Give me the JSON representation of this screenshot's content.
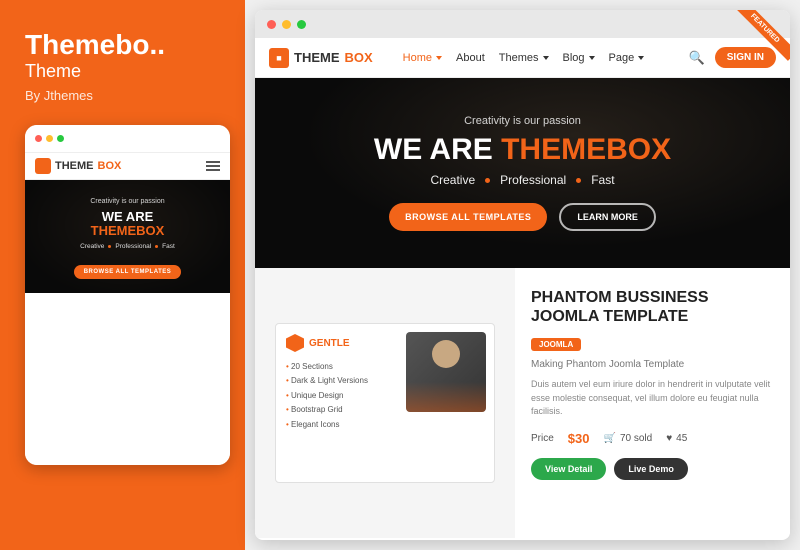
{
  "left": {
    "title": "Themebo..",
    "subtitle": "Theme",
    "author": "By Jthemes",
    "mobile": {
      "passion": "Creativity is our passion",
      "we_are": "WE ARE",
      "brand": "THEMEBOX",
      "tagline": [
        "Creative",
        "Professional",
        "Fast"
      ],
      "btn": "BROWSE ALL TEMPLATES"
    }
  },
  "browser": {
    "nav": {
      "logo_theme": "THEME",
      "logo_box": "BOX",
      "links": [
        "Home",
        "About",
        "Themes",
        "Blog",
        "Page"
      ],
      "signin": "SIGN IN",
      "search_placeholder": "Search..."
    },
    "hero": {
      "passion": "Creativity is our passion",
      "we_are": "WE ARE",
      "brand": "THEMEBOX",
      "tagline": [
        "Creative",
        "Professional",
        "Fast"
      ],
      "btn_browse": "BROWSE ALL TEMPLATES",
      "btn_learn": "LEARN MORE"
    },
    "product": {
      "card": {
        "logo": "GENTLE",
        "features": [
          "20 Sections",
          "Dark & Light Versions",
          "Unique Design",
          "Bootstrap Grid",
          "Elegant Icons"
        ]
      },
      "title": "PHANTOM BUSSINESS JOOMLA TEMPLATE",
      "badge": "JOOMLA",
      "subtitle": "Making Phantom Joomla Template",
      "description": "Duis autem vel eum iriure dolor in hendrerit in vulputate velit esse molestie consequat, vel illum dolore eu feugiat nulla facilisis.",
      "price_old": "$30",
      "sold": "70 sold",
      "likes": "45",
      "btn_view": "View Detail",
      "btn_demo": "Live Demo",
      "ribbon": "FEATURED"
    }
  }
}
